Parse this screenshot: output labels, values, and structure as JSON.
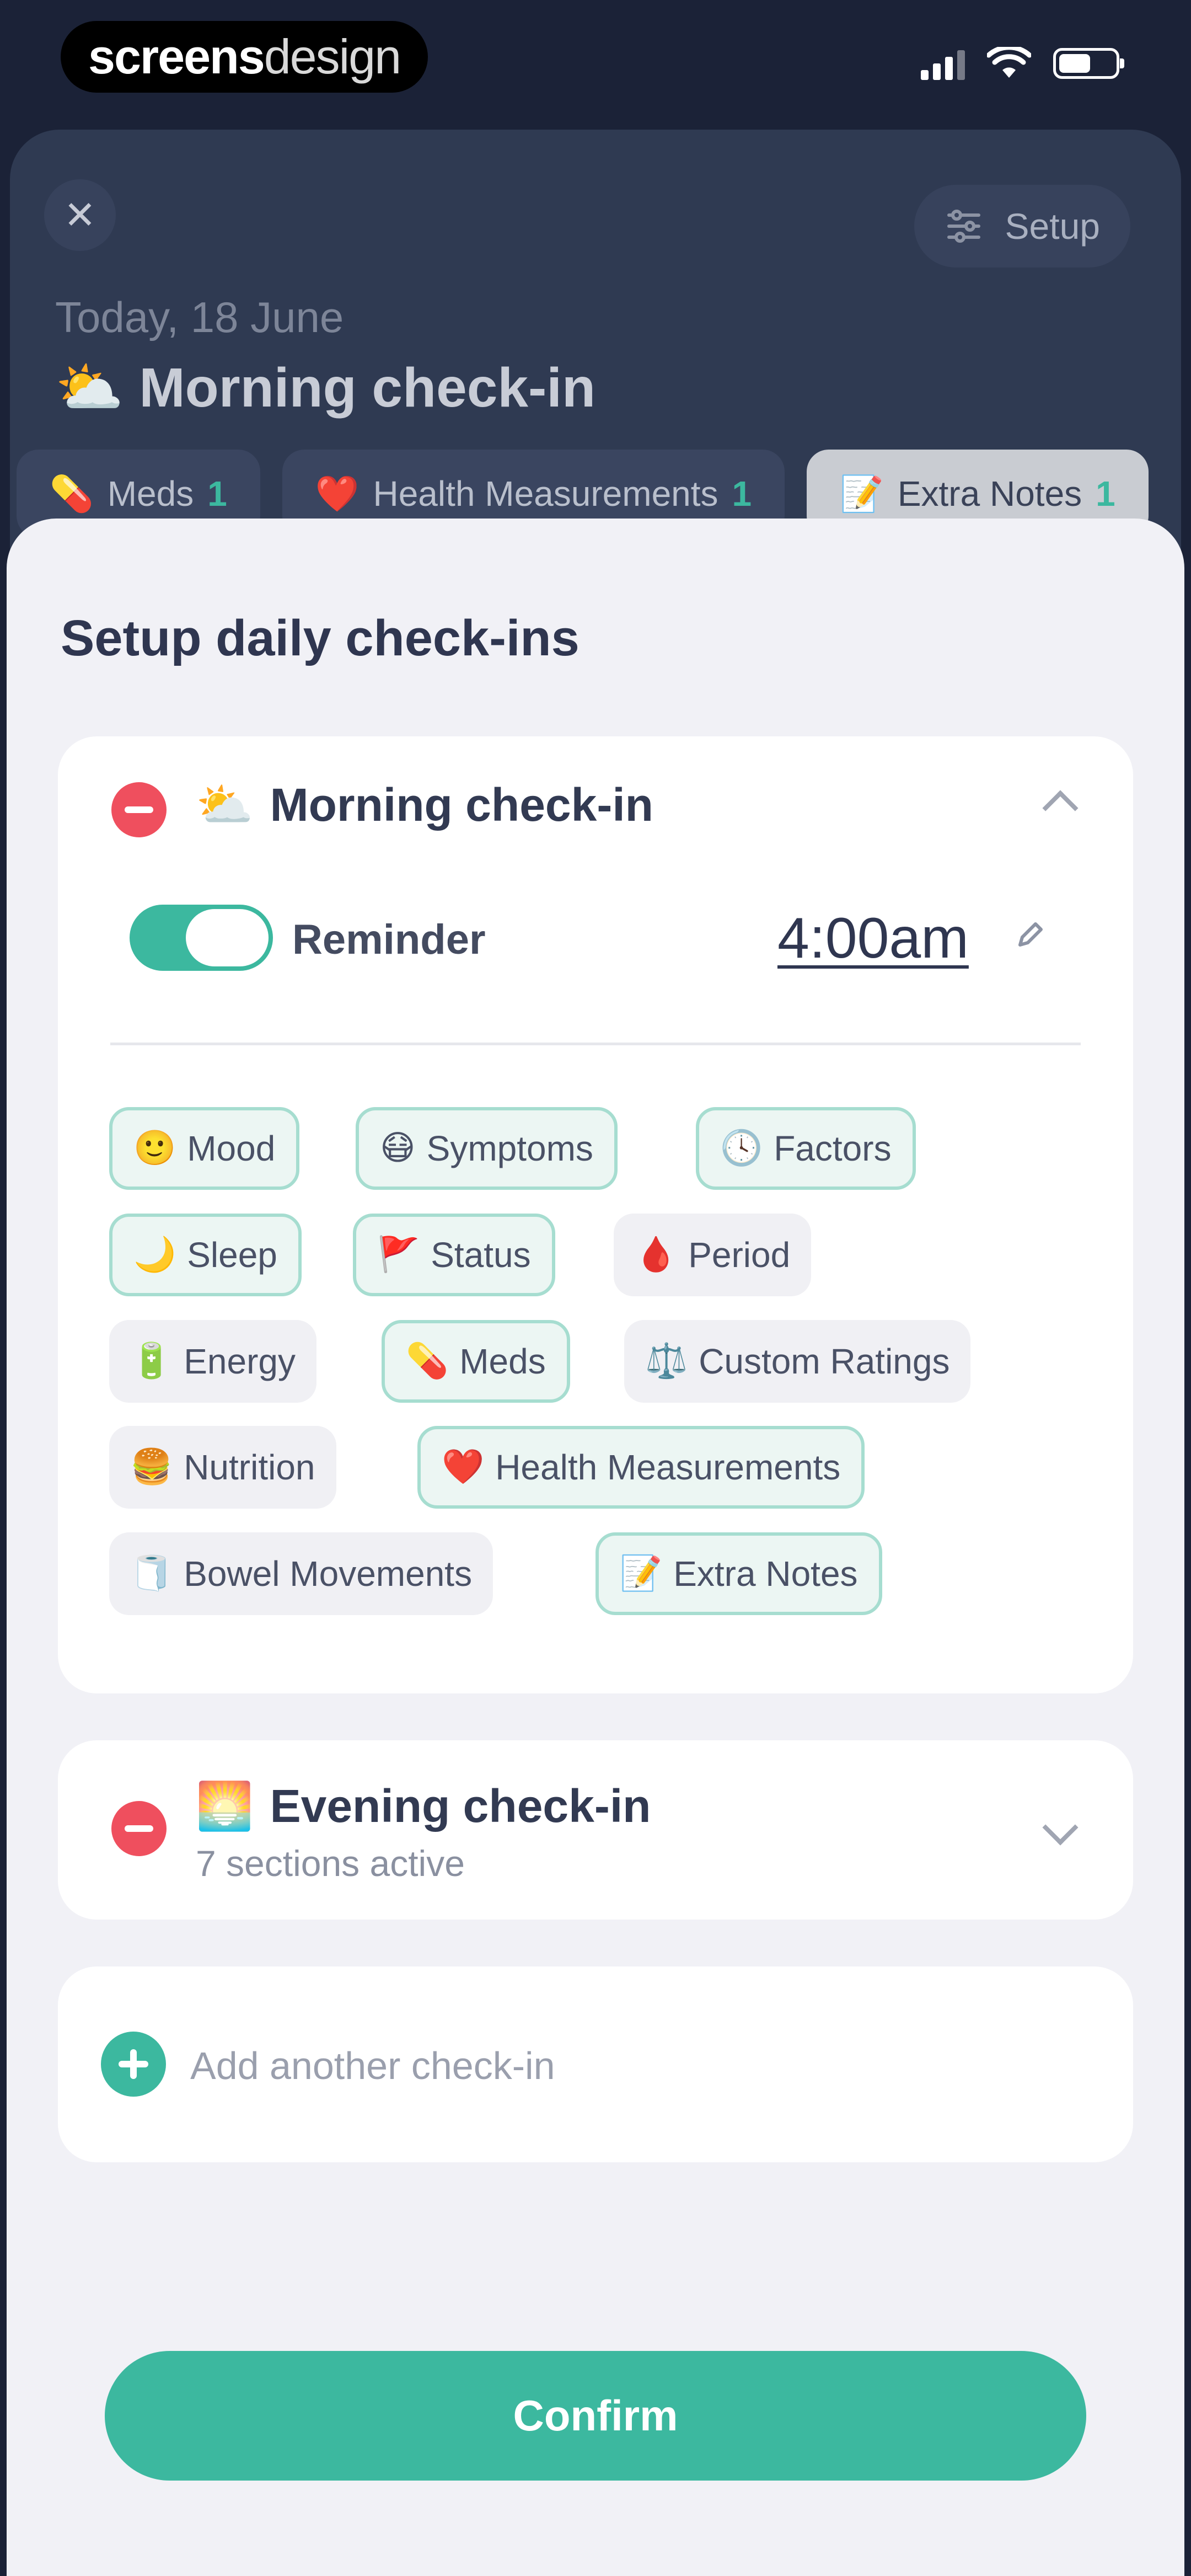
{
  "status_bar": {
    "brand_bold": "screens",
    "brand_light": "design"
  },
  "background": {
    "setup_label": "Setup",
    "date": "Today, 18 June",
    "title_emoji": "⛅",
    "title": "Morning check-in",
    "chips": [
      {
        "icon": "💊",
        "label": "Meds",
        "count": "1",
        "selected": false
      },
      {
        "icon": "❤️",
        "label": "Health Measurements",
        "count": "1",
        "selected": false
      },
      {
        "icon": "📝",
        "label": "Extra Notes",
        "count": "1",
        "selected": true
      }
    ]
  },
  "sheet": {
    "title": "Setup daily check-ins",
    "morning": {
      "emoji": "⛅",
      "title": "Morning check-in",
      "reminder_label": "Reminder",
      "reminder_on": true,
      "time": "4:00am",
      "sections": [
        {
          "icon": "🙂",
          "label": "Mood",
          "active": true
        },
        {
          "icon": "😷",
          "label": "Symptoms",
          "active": true
        },
        {
          "icon": "🕓",
          "label": "Factors",
          "active": true
        },
        {
          "icon": "🌙",
          "label": "Sleep",
          "active": true
        },
        {
          "icon": "🚩",
          "label": "Status",
          "active": true
        },
        {
          "icon": "🩸",
          "label": "Period",
          "active": false
        },
        {
          "icon": "🔋",
          "label": "Energy",
          "active": false
        },
        {
          "icon": "💊",
          "label": "Meds",
          "active": true
        },
        {
          "icon": "⚖️",
          "label": "Custom Ratings",
          "active": false
        },
        {
          "icon": "🍔",
          "label": "Nutrition",
          "active": false
        },
        {
          "icon": "❤️",
          "label": "Health Measurements",
          "active": true
        },
        {
          "icon": "🧻",
          "label": "Bowel Movements",
          "active": false
        },
        {
          "icon": "📝",
          "label": "Extra Notes",
          "active": true
        }
      ]
    },
    "evening": {
      "emoji": "🌅",
      "title": "Evening check-in",
      "subtitle": "7 sections active"
    },
    "add_label": "Add another check-in",
    "confirm_label": "Confirm"
  },
  "colors": {
    "accent": "#3cb89f",
    "danger": "#ef4f5e",
    "overlay": "#1b2237"
  }
}
